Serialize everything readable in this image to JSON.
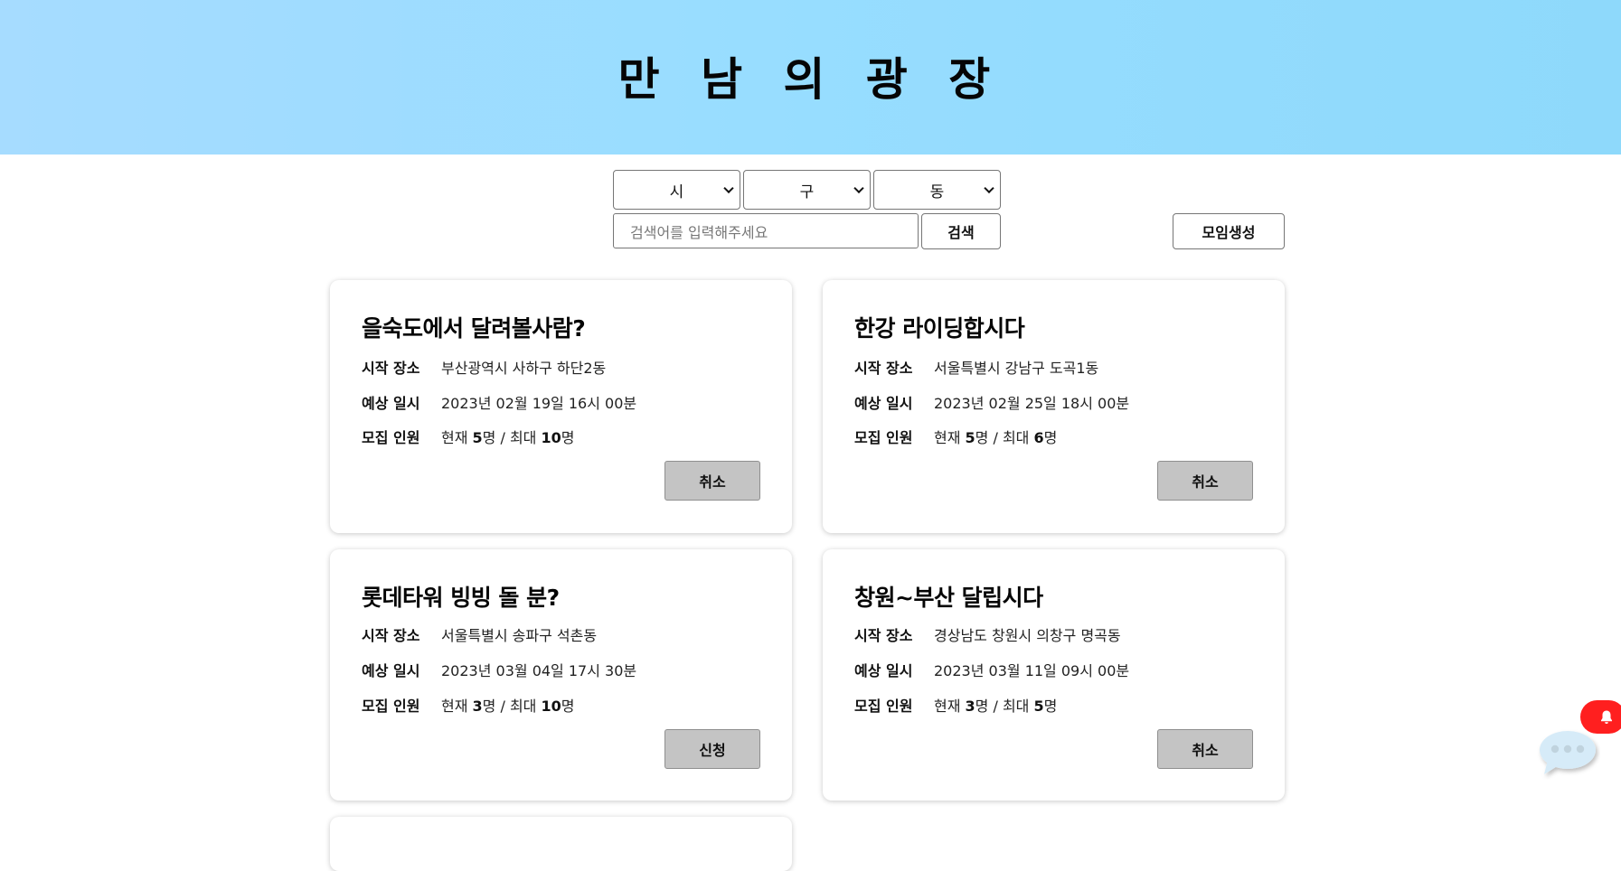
{
  "header": {
    "title": "만 남 의 광 장"
  },
  "filters": {
    "city": "시",
    "district": "구",
    "dong": "동"
  },
  "search": {
    "placeholder": "검색어를 입력해주세요",
    "button_label": "검색"
  },
  "create_button_label": "모임생성",
  "labels": {
    "start_place": "시작 장소",
    "expected_time": "예상 일시",
    "recruit": "모집 인원"
  },
  "cards": [
    {
      "title": "을숙도에서 달려볼사람?",
      "place": "부산광역시 사하구 하단2동",
      "datetime": "2023년 02월 19일 16시 00분",
      "count_prefix": "현재 ",
      "current": "5",
      "count_mid": "명 / 최대 ",
      "max": "10",
      "count_suffix": "명",
      "action": "취소"
    },
    {
      "title": "한강 라이딩합시다",
      "place": "서울특별시 강남구 도곡1동",
      "datetime": "2023년 02월 25일 18시 00분",
      "count_prefix": "현재 ",
      "current": "5",
      "count_mid": "명 / 최대 ",
      "max": "6",
      "count_suffix": "명",
      "action": "취소"
    },
    {
      "title": "롯데타워 빙빙 돌 분?",
      "place": "서울특별시 송파구 석촌동",
      "datetime": "2023년 03월 04일 17시 30분",
      "count_prefix": "현재 ",
      "current": "3",
      "count_mid": "명 / 최대 ",
      "max": "10",
      "count_suffix": "명",
      "action": "신청"
    },
    {
      "title": "창원~부산 달립시다",
      "place": "경상남도 창원시 의창구 명곡동",
      "datetime": "2023년 03월 11일 09시 00분",
      "count_prefix": "현재 ",
      "current": "3",
      "count_mid": "명 / 최대 ",
      "max": "5",
      "count_suffix": "명",
      "action": "취소"
    }
  ],
  "icons": {
    "notification": "bell-icon",
    "chat": "chat-bubble-icon"
  },
  "colors": {
    "header_bg": "#97ddff",
    "action_button_bg": "#c4c4c4",
    "notification_bg": "#ff1f1f",
    "chat_bubble": "#d6ebf8"
  }
}
